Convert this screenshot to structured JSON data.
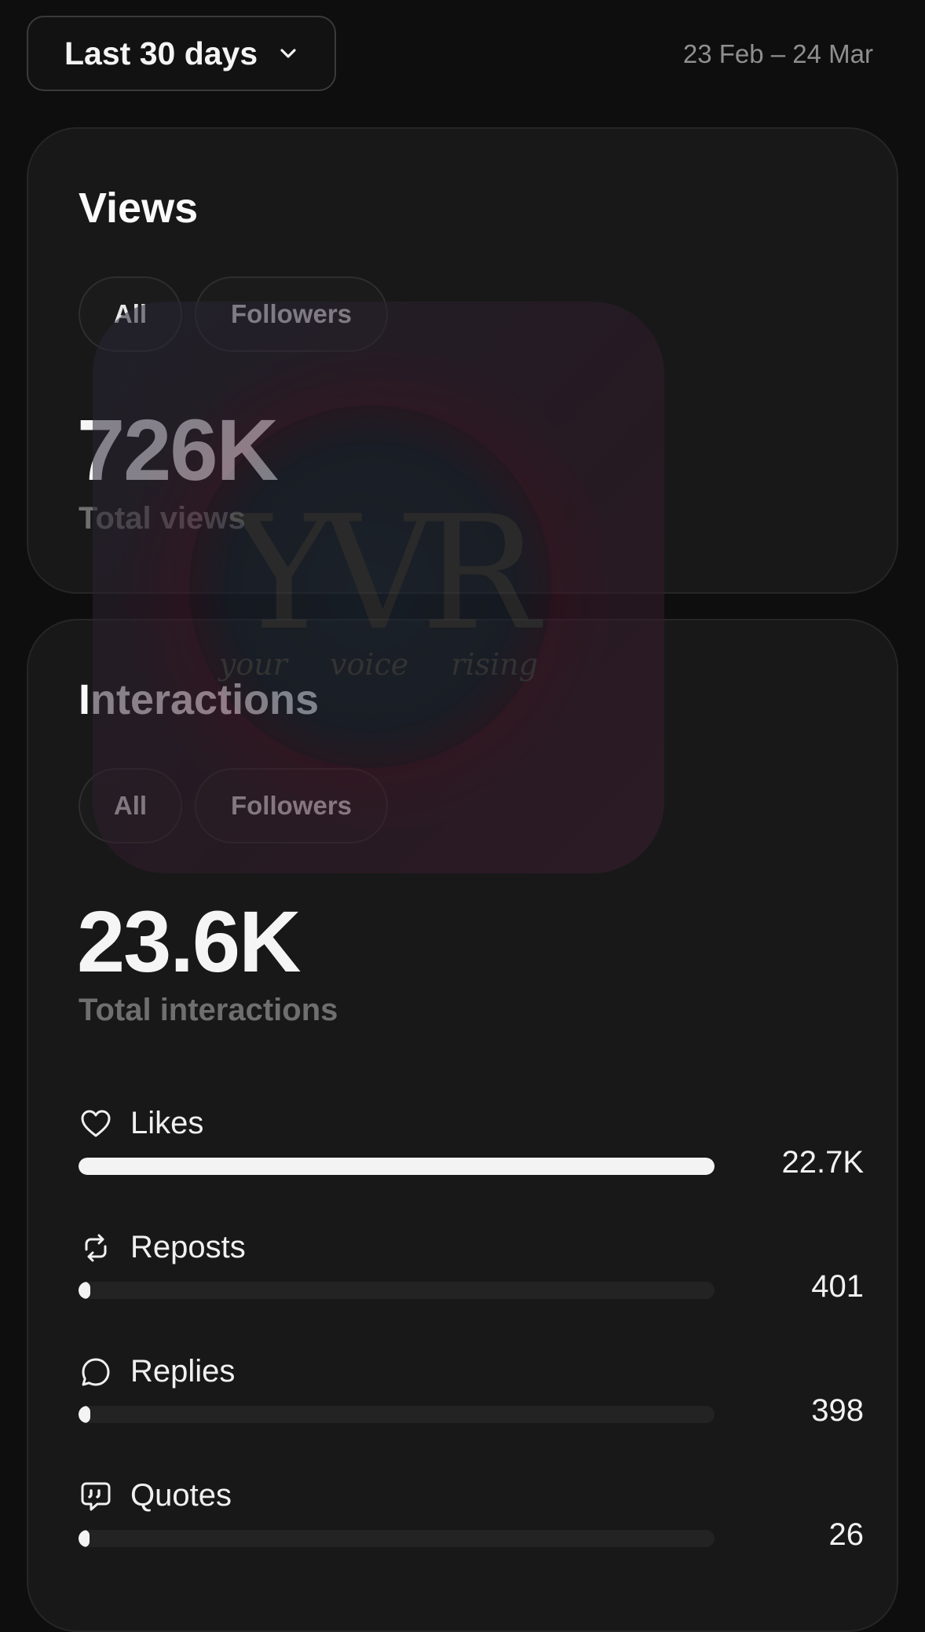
{
  "header": {
    "range_label": "Last 30 days",
    "date_range": "23 Feb – 24 Mar"
  },
  "views": {
    "title": "Views",
    "filters": [
      "All",
      "Followers"
    ],
    "total_value": "726K",
    "total_label": "Total views"
  },
  "interactions": {
    "title": "Interactions",
    "filters": [
      "All",
      "Followers"
    ],
    "total_value": "23.6K",
    "total_label": "Total interactions",
    "metrics": [
      {
        "label": "Likes",
        "value": "22.7K",
        "icon": "heart-icon",
        "fraction": 1.0
      },
      {
        "label": "Reposts",
        "value": "401",
        "icon": "repost-icon",
        "fraction": 0.018
      },
      {
        "label": "Replies",
        "value": "398",
        "icon": "reply-icon",
        "fraction": 0.018
      },
      {
        "label": "Quotes",
        "value": "26",
        "icon": "quote-icon",
        "fraction": 0.001
      }
    ]
  },
  "watermark": {
    "logo_text": "YVR",
    "tagline": "your voice rising"
  },
  "colors": {
    "background": "#0e0e0e",
    "card": "#181818",
    "bar_fill": "#f3f3f3",
    "bar_track": "#232323",
    "muted_text": "#6f6f6f"
  }
}
